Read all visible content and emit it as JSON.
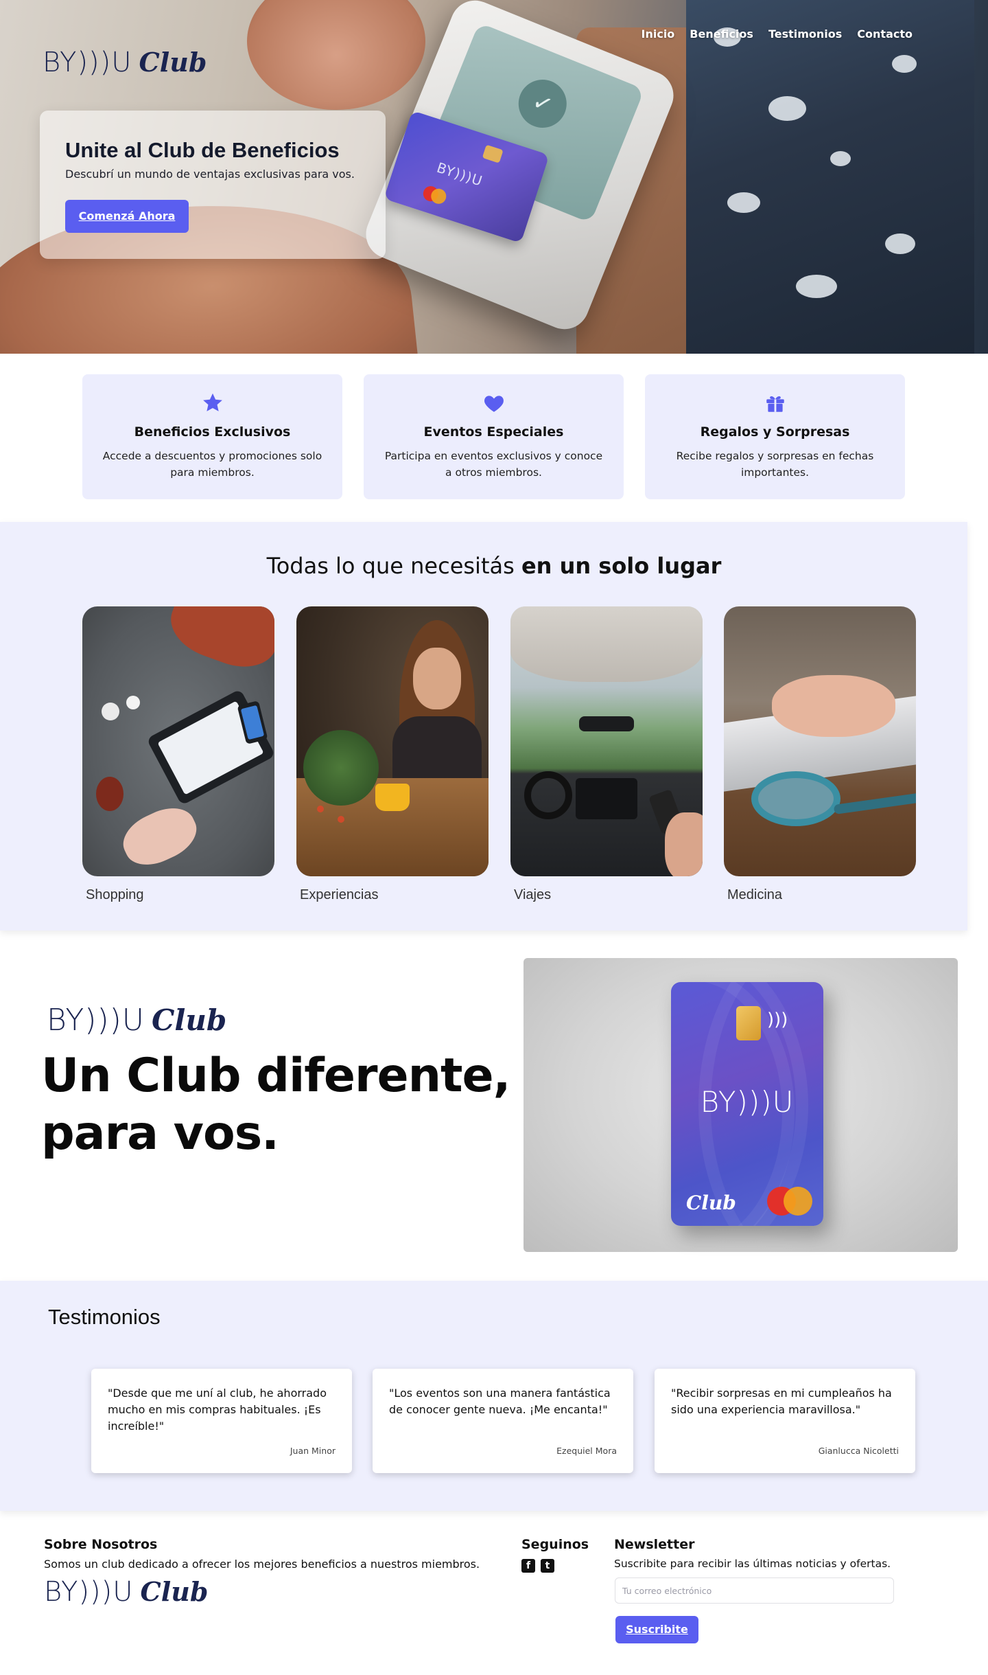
{
  "brand": {
    "name": "BY)))U",
    "club": "Club",
    "accent": "#5a5ef0",
    "soft_bg": "#eeeffd"
  },
  "nav": [
    {
      "label": "Inicio"
    },
    {
      "label": "Beneficios"
    },
    {
      "label": "Testimonios"
    },
    {
      "label": "Contacto"
    }
  ],
  "hero": {
    "title": "Unite al Club de Beneficios",
    "subtitle": "Descubrí un mundo de ventajas exclusivas para vos.",
    "cta": "Comenzá Ahora",
    "card_brand": "BY)))U"
  },
  "features": [
    {
      "icon": "star-icon",
      "title": "Beneficios Exclusivos",
      "text": "Accede a descuentos y promociones solo para miembros."
    },
    {
      "icon": "heart-icon",
      "title": "Eventos Especiales",
      "text": "Participa en eventos exclusivos y conoce a otros miembros."
    },
    {
      "icon": "gift-icon",
      "title": "Regalos y Sorpresas",
      "text": "Recibe regalos y sorpresas en fechas importantes."
    }
  ],
  "categories": {
    "title_regular": "Todas lo que necesitás ",
    "title_bold": "en un solo lugar",
    "items": [
      {
        "label": "Shopping"
      },
      {
        "label": "Experiencias"
      },
      {
        "label": "Viajes"
      },
      {
        "label": "Medicina"
      }
    ]
  },
  "about": {
    "line1": "Un Club diferente,",
    "line2": "para vos.",
    "card_brand": "BY)))U",
    "card_club": "Club"
  },
  "testimonials": {
    "title": "Testimonios",
    "items": [
      {
        "quote": "\"Desde que me uní al club, he ahorrado mucho en mis compras habituales. ¡Es increíble!\"",
        "author": "Juan Minor"
      },
      {
        "quote": "\"Los eventos son una manera fantástica de conocer gente nueva. ¡Me encanta!\"",
        "author": "Ezequiel Mora"
      },
      {
        "quote": "\"Recibir sorpresas en mi cumpleaños ha sido una experiencia maravillosa.\"",
        "author": "Gianlucca Nicoletti"
      }
    ]
  },
  "footer": {
    "about_title": "Sobre Nosotros",
    "about_text": "Somos un club dedicado a ofrecer los mejores beneficios a nuestros miembros.",
    "social_title": "Seguinos",
    "social": [
      {
        "icon": "facebook-icon",
        "glyph": "f"
      },
      {
        "icon": "twitter-icon",
        "glyph": "t"
      }
    ],
    "newsletter_title": "Newsletter",
    "newsletter_text": "Suscribite para recibir las últimas noticias y ofertas.",
    "newsletter_placeholder": "Tu correo electrónico",
    "newsletter_button": "Suscribite"
  }
}
